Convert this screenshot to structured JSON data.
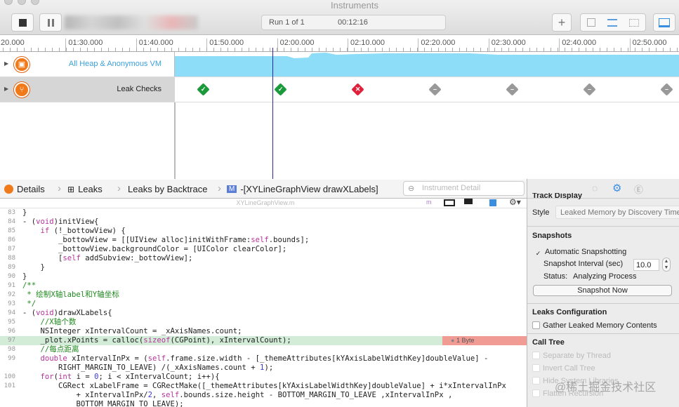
{
  "window": {
    "title": "Instruments"
  },
  "toolbar": {
    "run_label": "Run 1 of 1",
    "elapsed": "00:12:16",
    "add_label": "+"
  },
  "ruler": {
    "labels": [
      ":20.000",
      "01:30.000",
      "01:40.000",
      "01:50.000",
      "02:00.000",
      "02:10.000",
      "02:20.000",
      "02:30.000",
      "02:40.000",
      "02:50.000"
    ]
  },
  "tracks": [
    {
      "name": "All Heap & Anonymous VM",
      "color": "#8ddcf8"
    },
    {
      "name": "Leak Checks",
      "checks": [
        "pass",
        "pass",
        "fail",
        "none",
        "none",
        "none",
        "none"
      ]
    }
  ],
  "colors": {
    "pass": "#1a9a3a",
    "fail": "#e0203a",
    "none": "#999999",
    "playhead": "#2a2aa8"
  },
  "breadcrumb": {
    "items": [
      "Details",
      "Leaks",
      "Leaks by Backtrace",
      "-[XYLineGraphView drawXLabels]"
    ],
    "search_placeholder": "Instrument Detail"
  },
  "editor": {
    "filename": "XYLineGraphView.m",
    "leak_label": "1 Byte",
    "highlight_line": "97",
    "lines": [
      {
        "n": "83",
        "s": [
          [
            "}",
            ""
          ]
        ]
      },
      {
        "n": "84",
        "s": [
          [
            "- (",
            ""
          ],
          [
            "void",
            "kw"
          ],
          [
            ")initView{",
            ""
          ]
        ]
      },
      {
        "n": "85",
        "s": [
          [
            "    ",
            ""
          ],
          [
            "if",
            "kw"
          ],
          [
            " (!_bottowView) {",
            ""
          ]
        ]
      },
      {
        "n": "86",
        "s": [
          [
            "        _bottowView = [[UIView alloc]initWithFrame:",
            ""
          ],
          [
            "self",
            "kw"
          ],
          [
            ".bounds];",
            ""
          ]
        ]
      },
      {
        "n": "87",
        "s": [
          [
            "        _bottowView.backgroundColor = [UIColor clearColor];",
            ""
          ]
        ]
      },
      {
        "n": "88",
        "s": [
          [
            "        [",
            ""
          ],
          [
            "self",
            "kw"
          ],
          [
            " addSubview:_bottowView];",
            ""
          ]
        ]
      },
      {
        "n": "89",
        "s": [
          [
            "    }",
            ""
          ]
        ]
      },
      {
        "n": "90",
        "s": [
          [
            "}",
            ""
          ]
        ]
      },
      {
        "n": "91",
        "s": [
          [
            "/**",
            "cm"
          ]
        ]
      },
      {
        "n": "92",
        "s": [
          [
            " * 绘制X轴label和Y轴坐标",
            "cm"
          ]
        ]
      },
      {
        "n": "93",
        "s": [
          [
            " */",
            "cm"
          ]
        ]
      },
      {
        "n": "94",
        "s": [
          [
            "- (",
            ""
          ],
          [
            "void",
            "kw"
          ],
          [
            ")drawXLabels{",
            ""
          ]
        ]
      },
      {
        "n": "95",
        "s": [
          [
            "    //X轴个数",
            "cm"
          ]
        ]
      },
      {
        "n": "96",
        "s": [
          [
            "    NSInteger xIntervalCount = _xAxisNames.count;",
            ""
          ]
        ]
      },
      {
        "n": "97",
        "s": [
          [
            "    _plot.xPoints = calloc(",
            ""
          ],
          [
            "sizeof",
            "kw"
          ],
          [
            "(CGPoint), xIntervalCount);",
            ""
          ]
        ]
      },
      {
        "n": "98",
        "s": [
          [
            "    //每点距离",
            "cm"
          ]
        ]
      },
      {
        "n": "99",
        "s": [
          [
            "    ",
            ""
          ],
          [
            "double",
            "kw"
          ],
          [
            " xIntervalInPx = (",
            ""
          ],
          [
            "self",
            "kw"
          ],
          [
            ".frame.size.width - [_themeAttributes[kYAxisLabelWidthKey]doubleValue] -",
            ""
          ]
        ]
      },
      {
        "n": "",
        "s": [
          [
            "        RIGHT_MARGIN_TO_LEAVE) /(_xAxisNames.count + ",
            ""
          ],
          [
            "1",
            "nm"
          ],
          [
            ");",
            ""
          ]
        ]
      },
      {
        "n": "100",
        "s": [
          [
            "    ",
            ""
          ],
          [
            "for",
            "kw"
          ],
          [
            "(",
            ""
          ],
          [
            "int",
            "kw"
          ],
          [
            " i = ",
            ""
          ],
          [
            "0",
            "nm"
          ],
          [
            "; i < xIntervalCount; i++){",
            ""
          ]
        ]
      },
      {
        "n": "101",
        "s": [
          [
            "        CGRect xLabelFrame = CGRectMake([_themeAttributes[kYAxisLabelWidthKey]doubleValue] + i*xIntervalInPx",
            ""
          ]
        ]
      },
      {
        "n": "",
        "s": [
          [
            "            + xIntervalInPx/",
            ""
          ],
          [
            "2",
            "nm"
          ],
          [
            ", ",
            ""
          ],
          [
            "self",
            "kw"
          ],
          [
            ".bounds.size.height - BOTTOM_MARGIN_TO_LEAVE ,xIntervalInPx ,",
            ""
          ]
        ]
      },
      {
        "n": "",
        "s": [
          [
            "            BOTTOM_MARGIN_TO_LEAVE);",
            ""
          ]
        ]
      }
    ]
  },
  "inspector": {
    "section_cut": "Track Display",
    "style_label": "Style",
    "style_value": "Leaked Memory by Discovery Time",
    "snapshots_header": "Snapshots",
    "auto_snapshot_label": "Automatic Snapshotting",
    "auto_snapshot_checked": true,
    "interval_label": "Snapshot Interval (sec)",
    "interval_value": "10.0",
    "status_label": "Status:",
    "status_value": "Analyzing Process",
    "snapshot_now": "Snapshot Now",
    "leaks_config_header": "Leaks Configuration",
    "gather_label": "Gather Leaked Memory Contents",
    "call_tree_header": "Call Tree",
    "call_tree_options": [
      "Separate by Thread",
      "Invert Call Tree",
      "Hide System Libraries",
      "Flatten Recursion"
    ]
  },
  "watermark": "@稀土掘金技术社区"
}
